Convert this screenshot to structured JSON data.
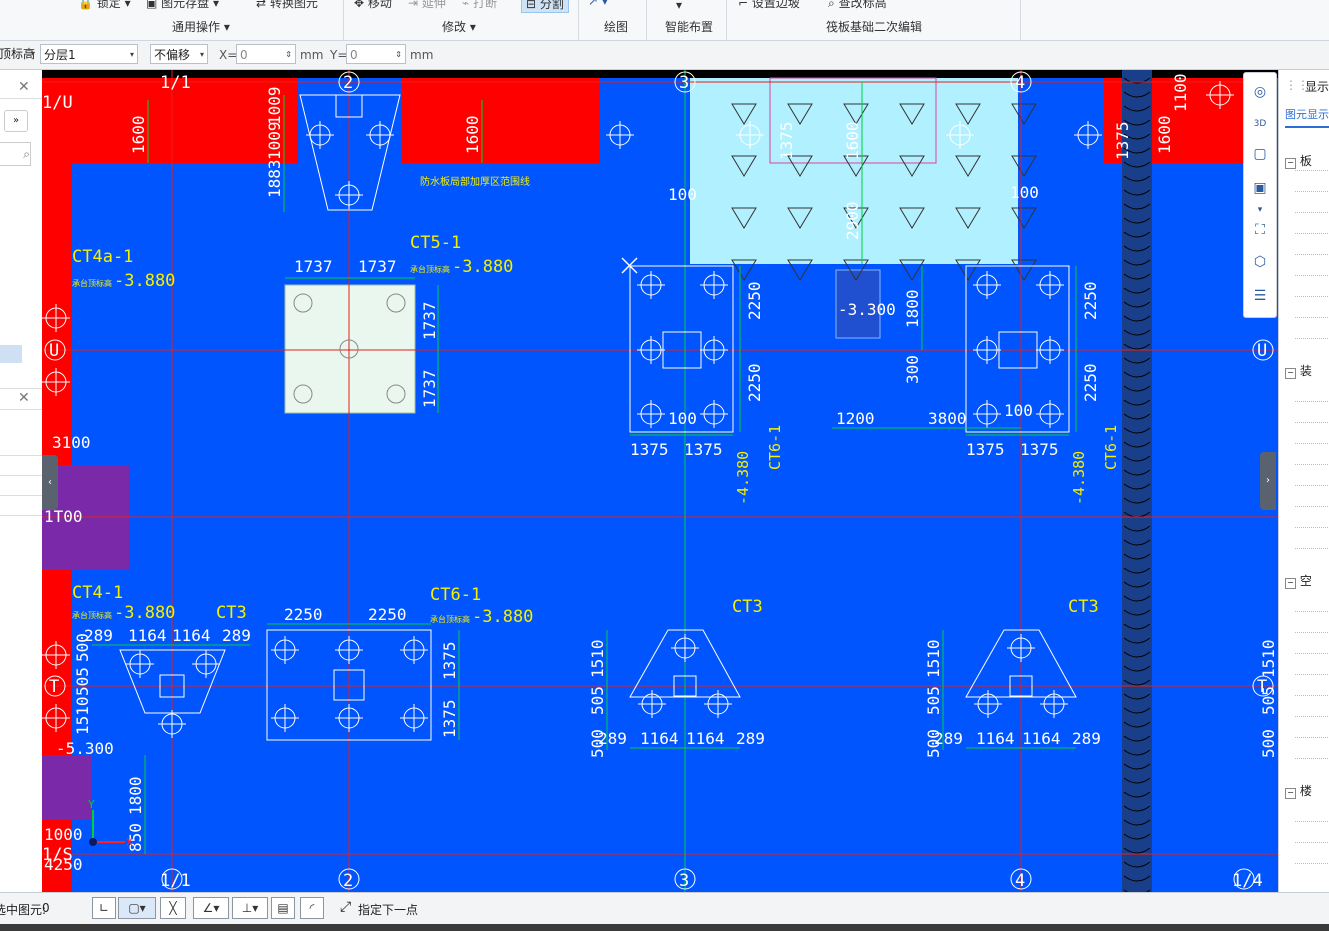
{
  "ribbon": {
    "lock": "锁定",
    "save_element": "图元存盘",
    "convert_element": "转换图元",
    "move": "移动",
    "extend": "延伸",
    "break": "打断",
    "split": "分割",
    "set_slope": "设置边坡",
    "view_elevation": "查改标高",
    "group_general": "通用操作",
    "group_modify": "修改",
    "group_draw": "绘图",
    "group_smart": "智能布置",
    "group_raft": "筏板基础二次编辑"
  },
  "options": {
    "elevation_label": "顶标高",
    "layer_value": "分层1",
    "offset_mode": "不偏移",
    "x_label": "X=",
    "x_value": "0",
    "y_label": "Y=",
    "y_value": "0",
    "unit": "mm"
  },
  "canvas": {
    "axis_labels": {
      "top": [
        "1/1",
        "2",
        "3",
        "4"
      ],
      "bottom": [
        "1/1",
        "2",
        "3",
        "4",
        "1/4"
      ],
      "left": [
        "1/U",
        "U",
        "T",
        "1/S"
      ],
      "right": [
        "U",
        "T"
      ]
    },
    "cap_labels": {
      "ct4a_1": "CT4a-1",
      "ct5_1": "CT5-1",
      "ct4_1": "CT4-1",
      "ct6_1_left": "CT6-1",
      "ct3": "CT3",
      "ct6_1_vert": "CT6-1",
      "cap_elev_prefix": "承台顶标高",
      "elev_3880": "-3.880",
      "elev_4380": "-4.380",
      "elev_3300": "-3.300",
      "elev_5300": "-5.300",
      "annot_top": "防水板局部加厚区范围线"
    },
    "dims": {
      "d1600": "1600",
      "d1009": "1009",
      "d1883": "1883",
      "d100": "100",
      "d1375": "1375",
      "d1737": "1737",
      "d2250": "2250",
      "d2900": "2900",
      "d1800": "1800",
      "d300": "300",
      "d1200": "1200",
      "d3800": "3800",
      "d1164": "1164",
      "d289": "289",
      "d1510": "1510",
      "d505": "505",
      "d500": "500",
      "d3100": "3100",
      "d1000": "1000",
      "d850": "850",
      "d4250": "4250",
      "d1100": "1100",
      "d1T00": "1T00"
    }
  },
  "status": {
    "selected_label": "选中图元:",
    "selected_count": "0",
    "prompt": "指定下一点"
  },
  "right_panel": {
    "display_tab": "显示",
    "element_display": "图元显示",
    "tree": [
      "板",
      "装",
      "空",
      "楼"
    ]
  },
  "colors": {
    "canvas_bg": "#0055ff",
    "red_fill": "#ff0000",
    "cyan_fill": "#b0f0ff",
    "cap_white": "#eaf7ee",
    "purple": "#7a2aa8",
    "axis_red": "#e0201c",
    "grid_green": "#00d040",
    "dim_white": "#ffffff",
    "label_yellow": "#f5f000"
  }
}
